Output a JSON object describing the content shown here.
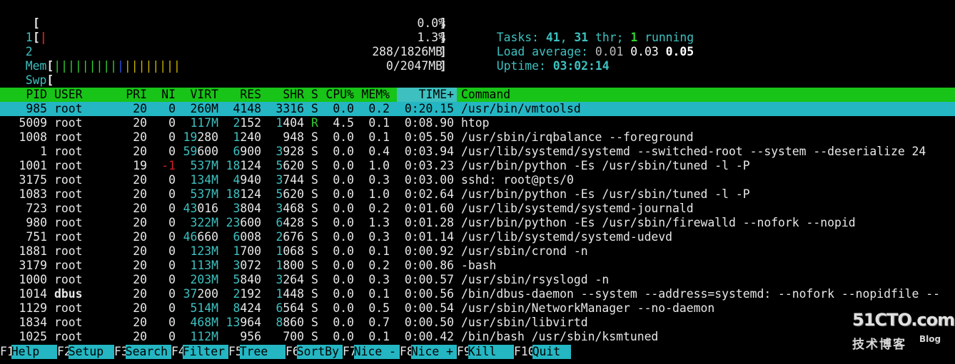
{
  "meters": {
    "cpu1": {
      "label": "1",
      "value": "0.0%"
    },
    "cpu2": {
      "label": "2",
      "value": "1.3%"
    },
    "mem": {
      "label": "Mem",
      "value": "288/1826MB",
      "bar": "||||||||||||||||||||"
    },
    "swp": {
      "label": "Swp",
      "value": "0/2047MB"
    }
  },
  "summary": {
    "tasks_label": "Tasks:",
    "tasks": "41",
    "threads": "31",
    "thr_label": "thr;",
    "running": "1",
    "running_label": "running",
    "load_label": "Load average:",
    "load1": "0.01",
    "load5": "0.03",
    "load15": "0.05",
    "uptime_label": "Uptime:",
    "uptime": "03:02:14"
  },
  "columns": [
    "PID",
    "USER",
    "PRI",
    "NI",
    "VIRT",
    "RES",
    "SHR",
    "S",
    "CPU%",
    "MEM%",
    "TIME+",
    "Command"
  ],
  "processes": [
    {
      "pid": "985",
      "user": "root",
      "pri": "20",
      "ni": "0",
      "virt": "260M",
      "res": "4148",
      "shr": "3316",
      "s": "S",
      "cpu": "0.0",
      "mem": "0.2",
      "time": "0:20.15",
      "cmd": "/usr/bin/vmtoolsd"
    },
    {
      "pid": "5009",
      "user": "root",
      "pri": "20",
      "ni": "0",
      "virt": "117M",
      "res": "2152",
      "shr": "1404",
      "s": "R",
      "cpu": "4.5",
      "mem": "0.1",
      "time": "0:08.90",
      "cmd": "htop"
    },
    {
      "pid": "1008",
      "user": "root",
      "pri": "20",
      "ni": "0",
      "virt": "19280",
      "res": "1240",
      "shr": "948",
      "s": "S",
      "cpu": "0.0",
      "mem": "0.1",
      "time": "0:05.50",
      "cmd": "/usr/sbin/irqbalance --foreground"
    },
    {
      "pid": "1",
      "user": "root",
      "pri": "20",
      "ni": "0",
      "virt": "59600",
      "res": "6900",
      "shr": "3928",
      "s": "S",
      "cpu": "0.0",
      "mem": "0.4",
      "time": "0:03.94",
      "cmd": "/usr/lib/systemd/systemd --switched-root --system --deserialize 24"
    },
    {
      "pid": "1001",
      "user": "root",
      "pri": "19",
      "ni": "-1",
      "virt": "537M",
      "res": "18124",
      "shr": "5620",
      "s": "S",
      "cpu": "0.0",
      "mem": "1.0",
      "time": "0:03.23",
      "cmd": "/usr/bin/python -Es /usr/sbin/tuned -l -P"
    },
    {
      "pid": "3175",
      "user": "root",
      "pri": "20",
      "ni": "0",
      "virt": "134M",
      "res": "4940",
      "shr": "3744",
      "s": "S",
      "cpu": "0.0",
      "mem": "0.3",
      "time": "0:03.00",
      "cmd": "sshd: root@pts/0"
    },
    {
      "pid": "1083",
      "user": "root",
      "pri": "20",
      "ni": "0",
      "virt": "537M",
      "res": "18124",
      "shr": "5620",
      "s": "S",
      "cpu": "0.0",
      "mem": "1.0",
      "time": "0:02.64",
      "cmd": "/usr/bin/python -Es /usr/sbin/tuned -l -P"
    },
    {
      "pid": "723",
      "user": "root",
      "pri": "20",
      "ni": "0",
      "virt": "43016",
      "res": "3804",
      "shr": "3468",
      "s": "S",
      "cpu": "0.0",
      "mem": "0.2",
      "time": "0:01.60",
      "cmd": "/usr/lib/systemd/systemd-journald"
    },
    {
      "pid": "980",
      "user": "root",
      "pri": "20",
      "ni": "0",
      "virt": "322M",
      "res": "23600",
      "shr": "6428",
      "s": "S",
      "cpu": "0.0",
      "mem": "1.3",
      "time": "0:01.28",
      "cmd": "/usr/bin/python -Es /usr/sbin/firewalld --nofork --nopid"
    },
    {
      "pid": "751",
      "user": "root",
      "pri": "20",
      "ni": "0",
      "virt": "46660",
      "res": "6008",
      "shr": "2676",
      "s": "S",
      "cpu": "0.0",
      "mem": "0.3",
      "time": "0:01.14",
      "cmd": "/usr/lib/systemd/systemd-udevd"
    },
    {
      "pid": "1881",
      "user": "root",
      "pri": "20",
      "ni": "0",
      "virt": "123M",
      "res": "1700",
      "shr": "1068",
      "s": "S",
      "cpu": "0.0",
      "mem": "0.1",
      "time": "0:00.92",
      "cmd": "/usr/sbin/crond -n"
    },
    {
      "pid": "3179",
      "user": "root",
      "pri": "20",
      "ni": "0",
      "virt": "113M",
      "res": "3072",
      "shr": "1800",
      "s": "S",
      "cpu": "0.0",
      "mem": "0.2",
      "time": "0:00.86",
      "cmd": "-bash"
    },
    {
      "pid": "1000",
      "user": "root",
      "pri": "20",
      "ni": "0",
      "virt": "203M",
      "res": "5840",
      "shr": "3264",
      "s": "S",
      "cpu": "0.0",
      "mem": "0.3",
      "time": "0:00.57",
      "cmd": "/usr/sbin/rsyslogd -n"
    },
    {
      "pid": "1014",
      "user": "dbus",
      "pri": "20",
      "ni": "0",
      "virt": "37200",
      "res": "2192",
      "shr": "1448",
      "s": "S",
      "cpu": "0.0",
      "mem": "0.1",
      "time": "0:00.56",
      "cmd": "/bin/dbus-daemon --system --address=systemd: --nofork --nopidfile --"
    },
    {
      "pid": "1129",
      "user": "root",
      "pri": "20",
      "ni": "0",
      "virt": "514M",
      "res": "8424",
      "shr": "6564",
      "s": "S",
      "cpu": "0.0",
      "mem": "0.5",
      "time": "0:00.54",
      "cmd": "/usr/sbin/NetworkManager --no-daemon"
    },
    {
      "pid": "1834",
      "user": "root",
      "pri": "20",
      "ni": "0",
      "virt": "468M",
      "res": "13964",
      "shr": "8860",
      "s": "S",
      "cpu": "0.0",
      "mem": "0.7",
      "time": "0:00.50",
      "cmd": "/usr/sbin/libvirtd"
    },
    {
      "pid": "1025",
      "user": "root",
      "pri": "20",
      "ni": "0",
      "virt": "112M",
      "res": "956",
      "shr": "700",
      "s": "S",
      "cpu": "0.0",
      "mem": "0.1",
      "time": "0:00.42",
      "cmd": "/bin/bash /usr/sbin/ksmtuned"
    }
  ],
  "function_keys": [
    {
      "key": "F1",
      "label": "Help"
    },
    {
      "key": "F2",
      "label": "Setup"
    },
    {
      "key": "F3",
      "label": "Search"
    },
    {
      "key": "F4",
      "label": "Filter"
    },
    {
      "key": "F5",
      "label": "Tree"
    },
    {
      "key": "F6",
      "label": "SortBy"
    },
    {
      "key": "F7",
      "label": "Nice -"
    },
    {
      "key": "F8",
      "label": "Nice +"
    },
    {
      "key": "F9",
      "label": "Kill"
    },
    {
      "key": "F10",
      "label": "Quit"
    }
  ],
  "watermark": {
    "main": "51CTO.com",
    "sub": "技术博客",
    "blog": "Blog"
  },
  "colors": {
    "header_bg": "#17c417",
    "selected_bg": "#24b6c2",
    "cyan": "#3ec0c0",
    "red": "#d02020",
    "green": "#2fcf2f"
  }
}
